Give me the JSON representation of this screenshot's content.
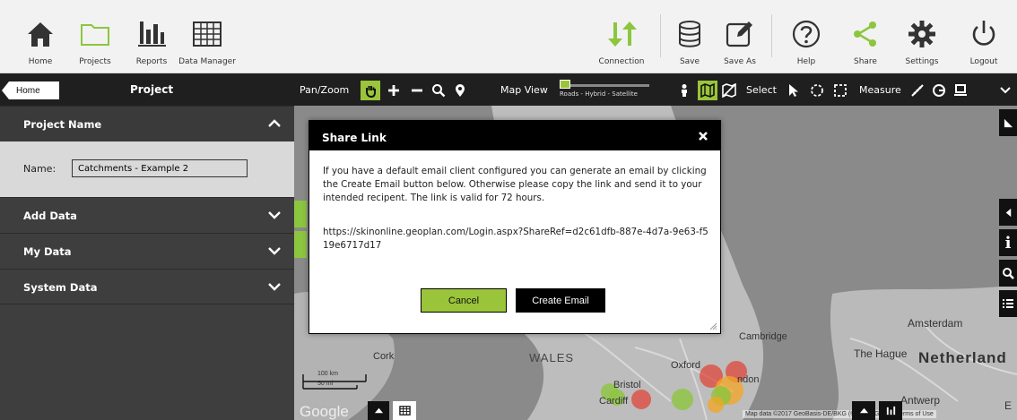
{
  "toolbar": {
    "left": [
      {
        "name": "home",
        "label": "Home",
        "icon": "home-icon"
      },
      {
        "name": "projects",
        "label": "Projects",
        "icon": "folder-icon"
      },
      {
        "name": "reports",
        "label": "Reports",
        "icon": "bar-chart-icon"
      },
      {
        "name": "data-manager",
        "label": "Data Manager",
        "icon": "grid-icon"
      }
    ],
    "right": [
      {
        "name": "connection",
        "label": "Connection",
        "icon": "arrows-updown-icon"
      },
      {
        "name": "save",
        "label": "Save",
        "icon": "database-icon"
      },
      {
        "name": "save-as",
        "label": "Save As",
        "icon": "edit-icon"
      },
      {
        "name": "help",
        "label": "Help",
        "icon": "help-icon"
      },
      {
        "name": "share",
        "label": "Share",
        "icon": "share-icon"
      },
      {
        "name": "settings",
        "label": "Settings",
        "icon": "gear-icon"
      },
      {
        "name": "logout",
        "label": "Logout",
        "icon": "power-icon"
      }
    ]
  },
  "leftpanel": {
    "home_label": "Home",
    "title": "Project",
    "sections": {
      "project_name": "Project Name",
      "add_data": "Add Data",
      "my_data": "My Data",
      "system_data": "System Data"
    },
    "name_label": "Name:",
    "name_value": "Catchments - Example 2"
  },
  "maptoolbar": {
    "panzoom": "Pan/Zoom",
    "mapview": "Map View",
    "mapview_options": "Roads - Hybrid - Satellite",
    "select": "Select",
    "measure": "Measure"
  },
  "map": {
    "labels": {
      "wales": "WALES",
      "cork": "Cork",
      "oxford": "Oxford",
      "bristol": "Bristol",
      "cardiff": "Cardiff",
      "london": "ndon",
      "cambridge": "Cambridge",
      "amsterdam": "Amsterdam",
      "the_hague": "The Hague",
      "netherlands": "Netherland",
      "antwerp": "Antwerp",
      "east": "E"
    },
    "scale_km": "100 km",
    "scale_mi": "50 mi",
    "google": "Google",
    "attribution": "Map data ©2017 GeoBasis-DE/BKG (©2009), Google   Terms of Use",
    "colors": {
      "cluster_green": "#8cc63f",
      "cluster_red": "#e0473a",
      "cluster_orange": "#f5a623"
    }
  },
  "modal": {
    "title": "Share Link",
    "message": "If you have a default email client configured you can generate an email by clicking the Create Email button below. Otherwise please copy the link and send it to your intended recipent. The link is valid for 72 hours.",
    "link": "https://skinonline.geoplan.com/Login.aspx?ShareRef=d2c61dfb-887e-4d7a-9e63-f519e6717d17",
    "cancel_label": "Cancel",
    "create_email_label": "Create Email"
  },
  "theme": {
    "accent": "#9ac53a",
    "dark": "#1f1f1f",
    "panel": "#3e3e3e"
  }
}
